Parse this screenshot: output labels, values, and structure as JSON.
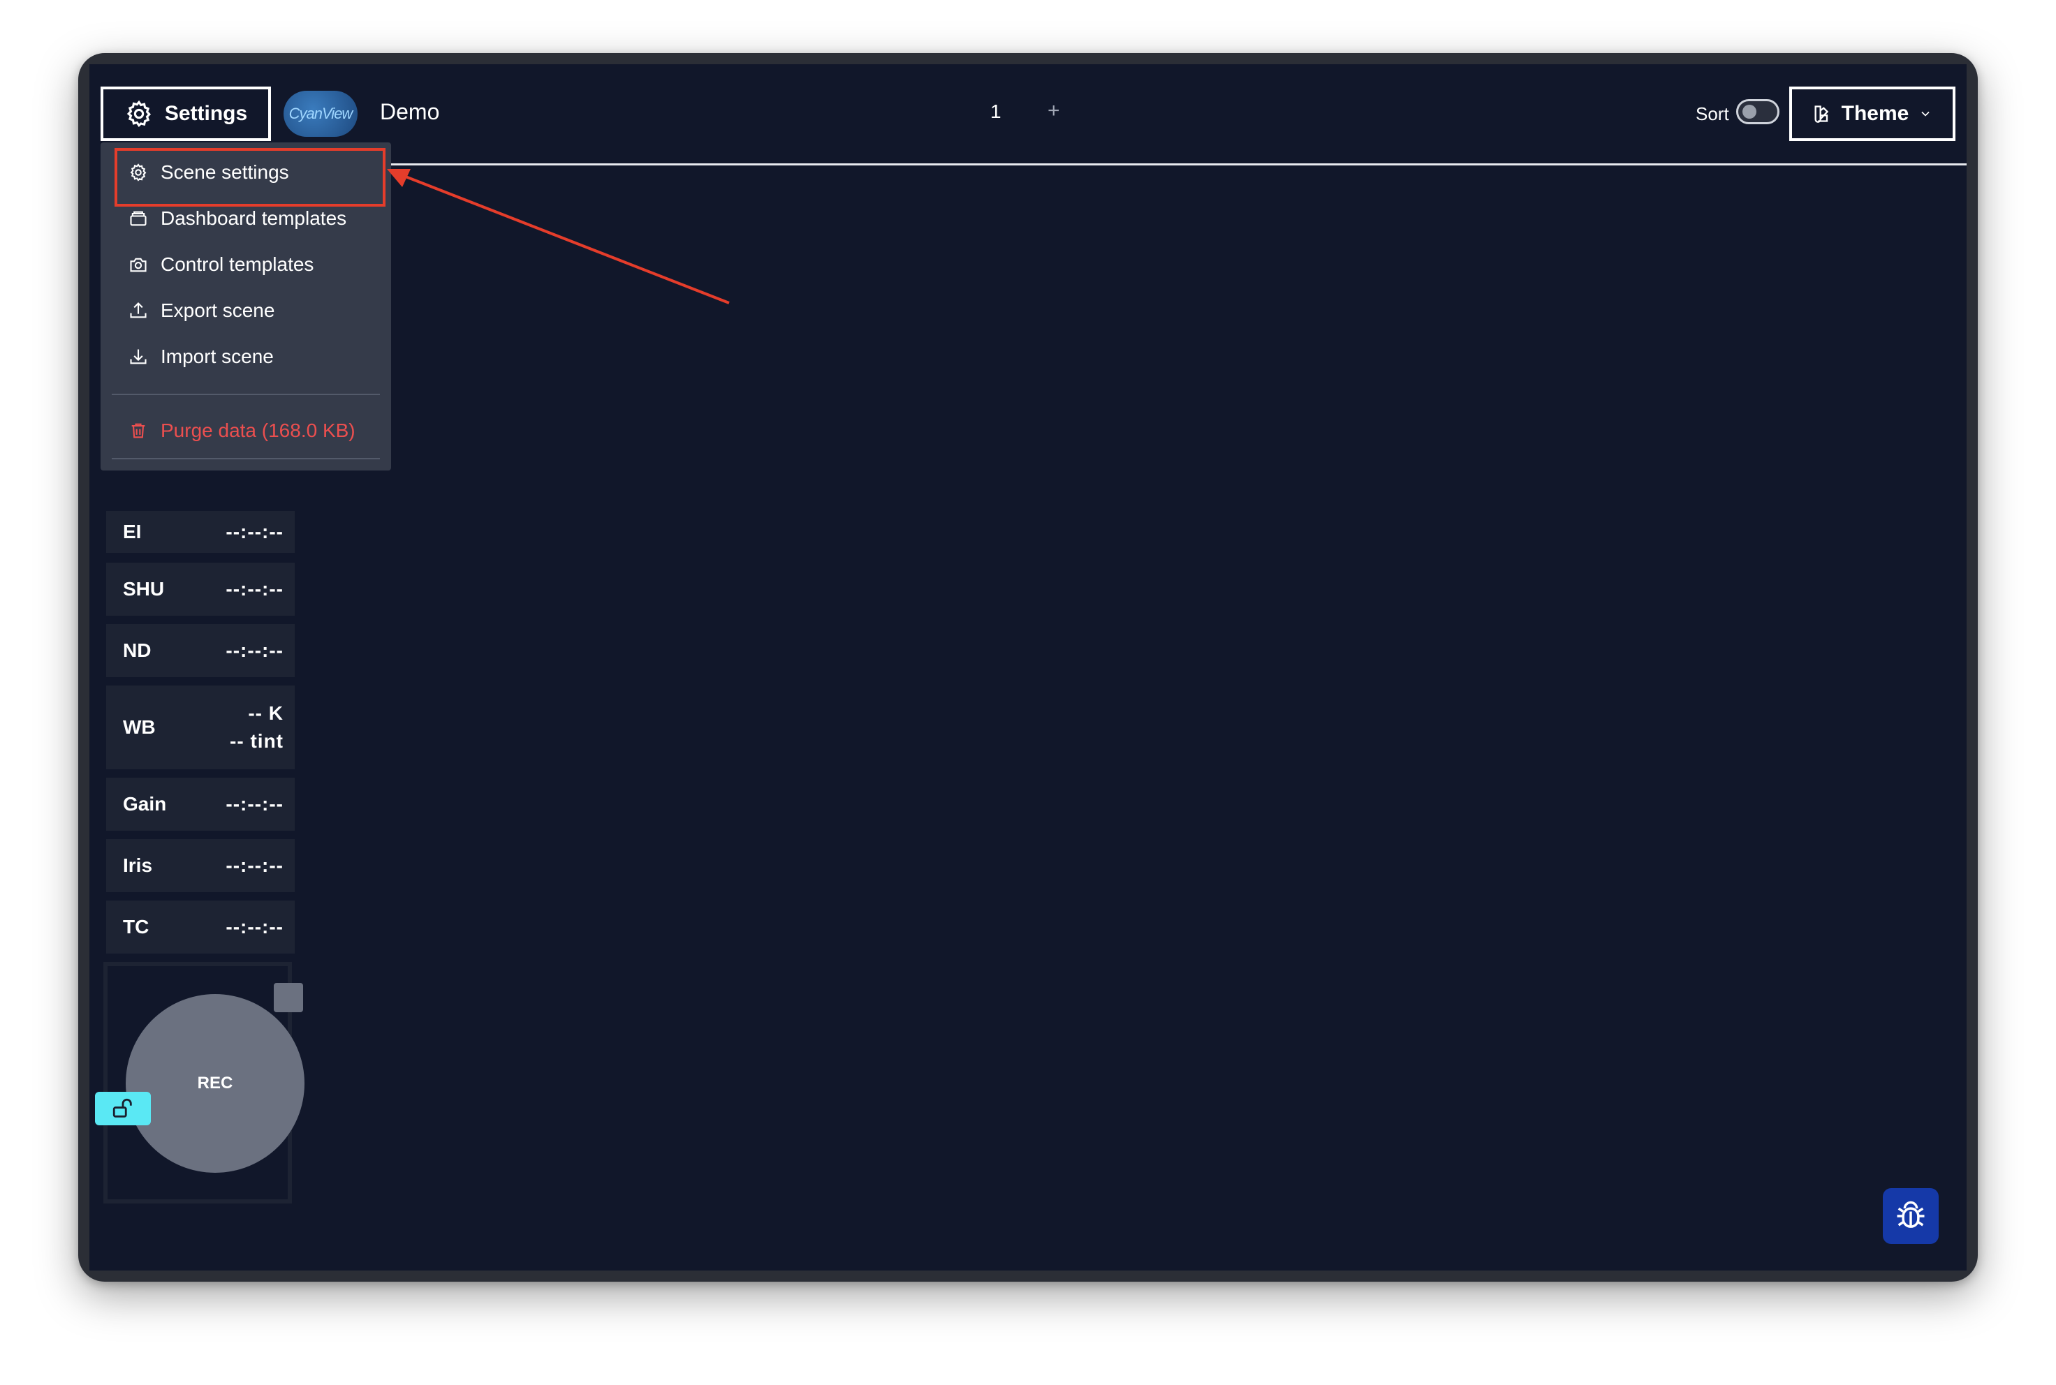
{
  "header": {
    "settings_label": "Settings",
    "logo_text": "CyanView",
    "scene_name": "Demo",
    "tabs": [
      {
        "label": "1"
      }
    ],
    "add_tab_label": "+",
    "sort_label": "Sort",
    "sort_enabled": false,
    "theme_label": "Theme"
  },
  "settings_menu": {
    "items": [
      {
        "label": "Scene settings",
        "icon": "gear-icon",
        "highlighted": true
      },
      {
        "label": "Dashboard templates",
        "icon": "layers-icon"
      },
      {
        "label": "Control templates",
        "icon": "camera-icon"
      },
      {
        "label": "Export scene",
        "icon": "upload-icon"
      },
      {
        "label": "Import scene",
        "icon": "download-icon"
      }
    ],
    "danger_item": {
      "label": "Purge data (168.0 KB)",
      "icon": "trash-icon"
    }
  },
  "camera_panel": {
    "rows": [
      {
        "label": "EI",
        "value": "--:--:--"
      },
      {
        "label": "SHU",
        "value": "--:--:--"
      },
      {
        "label": "ND",
        "value": "--:--:--"
      },
      {
        "label": "WB",
        "value_line1": "-- K",
        "value_line2": "-- tint"
      },
      {
        "label": "Gain",
        "value": "--:--:--"
      },
      {
        "label": "Iris",
        "value": "--:--:--"
      },
      {
        "label": "TC",
        "value": "--:--:--"
      }
    ],
    "rec_label": "REC"
  },
  "colors": {
    "background": "#11172a",
    "menu_background": "#353b4a",
    "danger": "#ec4f4f",
    "annotation": "#e53d2b",
    "lock_accent": "#5ae8f4",
    "bug_button": "#1539a8"
  }
}
